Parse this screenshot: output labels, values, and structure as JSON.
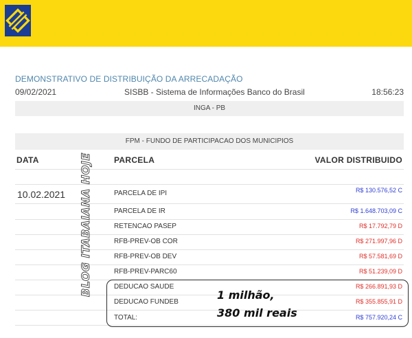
{
  "header": {
    "brand_color": "#fcd80f",
    "logo_icon": "banco-do-brasil-logo-icon"
  },
  "report": {
    "title": "DEMONSTRATIVO DE DISTRIBUIÇÃO DA ARRECADAÇÃO",
    "date": "09/02/2021",
    "system": "SISBB - Sistema de Informações Banco do Brasil",
    "time": "18:56:23",
    "municipality": "INGA - PB",
    "fund": "FPM - FUNDO DE PARTICIPACAO DOS MUNICIPIOS"
  },
  "table": {
    "headers": {
      "date": "DATA",
      "parcela": "PARCELA",
      "valor": "VALOR DISTRIBUIDO"
    },
    "entry_date": "10.02.2021",
    "rows": [
      {
        "parcela": "PARCELA DE IPI",
        "valor": "R$ 130.576,52 C",
        "type": "credit"
      },
      {
        "parcela": "PARCELA DE IR",
        "valor": "R$ 1.648.703,09 C",
        "type": "credit"
      },
      {
        "parcela": "RETENCAO PASEP",
        "valor": "R$ 17.792,79 D",
        "type": "debit"
      },
      {
        "parcela": "RFB-PREV-OB COR",
        "valor": "R$ 271.997,96 D",
        "type": "debit"
      },
      {
        "parcela": "RFB-PREV-OB DEV",
        "valor": "R$ 57.581,69 D",
        "type": "debit"
      },
      {
        "parcela": "RFB-PREV-PARC60",
        "valor": "R$ 51.239,09 D",
        "type": "debit"
      },
      {
        "parcela": "DEDUCAO SAUDE",
        "valor": "R$ 266.891,93 D",
        "type": "debit"
      },
      {
        "parcela": "DEDUCAO FUNDEB",
        "valor": "R$ 355.855,91 D",
        "type": "debit"
      },
      {
        "parcela": "TOTAL:",
        "valor": "R$ 757.920,24 C",
        "type": "credit"
      }
    ]
  },
  "overlay": {
    "watermark": "BLOG ITABAIANA HOJE",
    "annotation_line1": "1 milhão,",
    "annotation_line2": "380 mil reais"
  },
  "colors": {
    "credit": "#2f3fd4",
    "debit": "#e0302a",
    "title": "#4f86ac"
  }
}
